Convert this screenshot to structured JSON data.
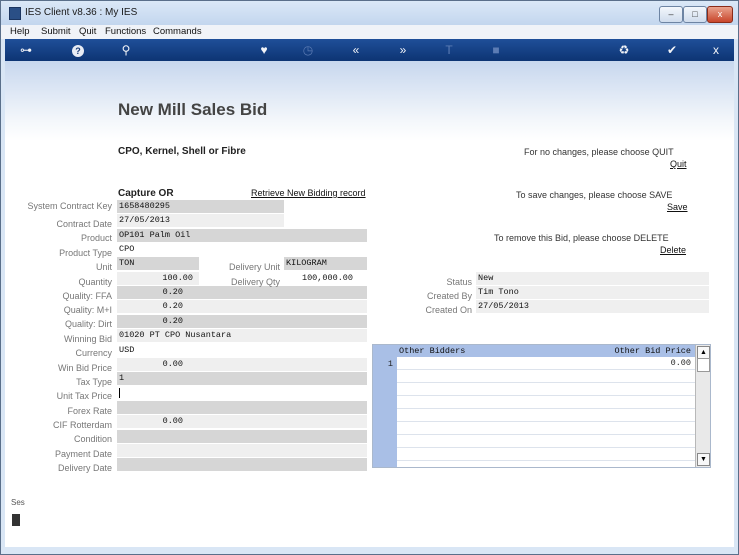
{
  "window": {
    "title": "IES Client v8.36 : My IES",
    "min": "–",
    "max": "□",
    "close": "x"
  },
  "menu": [
    "Help",
    "Submit",
    "Quit",
    "Functions",
    "Commands"
  ],
  "toolbar": {
    "key": "⊶",
    "help": "?",
    "search": "⚲",
    "heart": "♥",
    "history": "◷",
    "back": "«",
    "forward": "»",
    "text": "T",
    "stop": "■",
    "recycle": "♻",
    "ok": "✔",
    "close": "x"
  },
  "page": {
    "title": "New Mill Sales Bid",
    "subtitle": "CPO, Kernel, Shell or Fibre",
    "capture": "Capture OR",
    "retrieve_link": "Retrieve New Bidding record"
  },
  "actions": {
    "quit_text": "For no changes, please choose QUIT",
    "quit_link": "Quit",
    "save_text": "To save changes, please choose SAVE",
    "save_link": "Save",
    "delete_text": "To remove this Bid,  please choose  DELETE",
    "delete_link": "Delete"
  },
  "labels": {
    "contract_key": "System Contract Key",
    "contract_date": "Contract Date",
    "product": "Product",
    "product_type": "Product Type",
    "unit": "Unit",
    "quantity": "Quantity",
    "ffa": "Quality: FFA",
    "mi": "Quality: M+I",
    "dirt": "Quality: Dirt",
    "winning_bid": "Winning Bid",
    "currency": "Currency",
    "win_bid_price": "Win Bid Price",
    "tax_type": "Tax Type",
    "unit_tax_price": "Unit Tax Price",
    "forex_rate": "Forex Rate",
    "cif": "CIF Rotterdam",
    "condition": "Condition",
    "payment_date": "Payment Date",
    "delivery_date": "Delivery Date",
    "delivery_unit": "Delivery Unit",
    "delivery_qty": "Delivery Qty",
    "status": "Status",
    "created_by": "Created By",
    "created_on": "Created On"
  },
  "values": {
    "contract_key": "1658480295",
    "contract_date": "27/05/2013",
    "product": "OP101 Palm Oil",
    "product_type": "CPO",
    "unit": "TON",
    "quantity": "100.00",
    "ffa": "0.20",
    "mi": "0.20",
    "dirt": "0.20",
    "winning_bid": "01020 PT CPO Nusantara",
    "currency": "USD",
    "win_bid_price": "0.00",
    "tax_type": "1",
    "unit_tax_price": "",
    "forex_rate": "",
    "cif": "0.00",
    "condition": "",
    "payment_date": "",
    "delivery_date": "",
    "delivery_unit": "KILOGRAM",
    "delivery_qty": "100,000.00",
    "status": "New",
    "created_by": "Tim Tono",
    "created_on": "27/05/2013"
  },
  "bidders_grid": {
    "col_bidders": "Other Bidders",
    "col_price": "Other Bid Price",
    "rows": [
      {
        "num": "1",
        "bidder": "",
        "price": "0.00"
      }
    ]
  },
  "side": {
    "session": "Ses"
  }
}
